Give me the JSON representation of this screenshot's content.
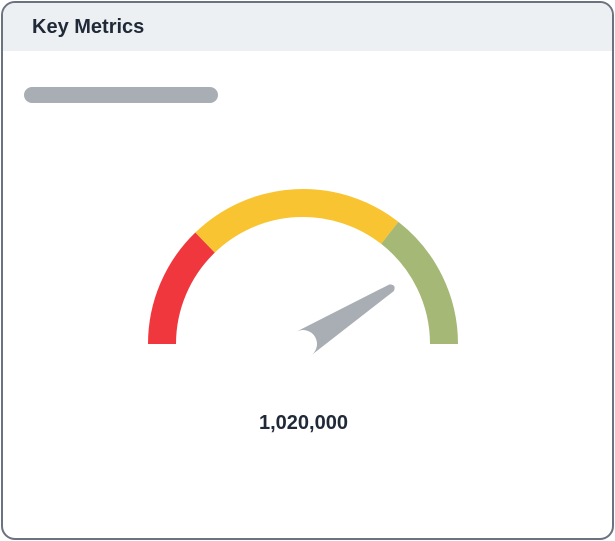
{
  "widget": {
    "title": "Key Metrics",
    "value_label": "1,020,000"
  },
  "gauge": {
    "needle_fraction": 0.82,
    "bands": [
      {
        "name": "low",
        "color": "#f0373e"
      },
      {
        "name": "mid",
        "color": "#f9c432"
      },
      {
        "name": "high",
        "color": "#a6b876"
      }
    ],
    "needle_color": "#a9aeb5"
  },
  "colors": {
    "border": "#6b7280",
    "header_bg": "#edf0f2",
    "placeholder": "#a9aeb5"
  }
}
